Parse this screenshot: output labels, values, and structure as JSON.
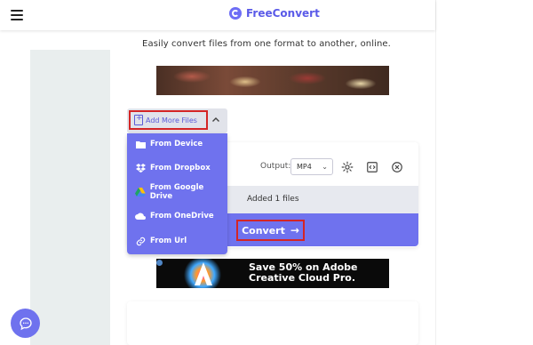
{
  "header": {
    "brand": "FreeConvert",
    "menu_icon": "hamburger-icon",
    "logo_icon": "freeconvert-logo-icon"
  },
  "tagline": "Easily convert files from one format to another, online.",
  "add_more": {
    "label": "Add More Files",
    "icon": "file-plus-icon",
    "toggle_icon": "chevron-up-icon"
  },
  "dropdown": {
    "items": [
      {
        "label": "From Device",
        "icon": "folder-icon"
      },
      {
        "label": "From Dropbox",
        "icon": "dropbox-icon"
      },
      {
        "label": "From Google Drive",
        "icon": "google-drive-icon"
      },
      {
        "label": "From OneDrive",
        "icon": "onedrive-icon"
      },
      {
        "label": "From Url",
        "icon": "link-icon"
      }
    ]
  },
  "converter": {
    "output_label": "Output:",
    "output_value": "MP4",
    "files_status": "Added 1 files",
    "convert_label": "Convert",
    "arrow": "→"
  },
  "ad": {
    "line1": "Save 50% on Adobe",
    "line2": "Creative Cloud Pro."
  },
  "colors": {
    "accent": "#6f72ee",
    "highlight": "#d42525"
  }
}
